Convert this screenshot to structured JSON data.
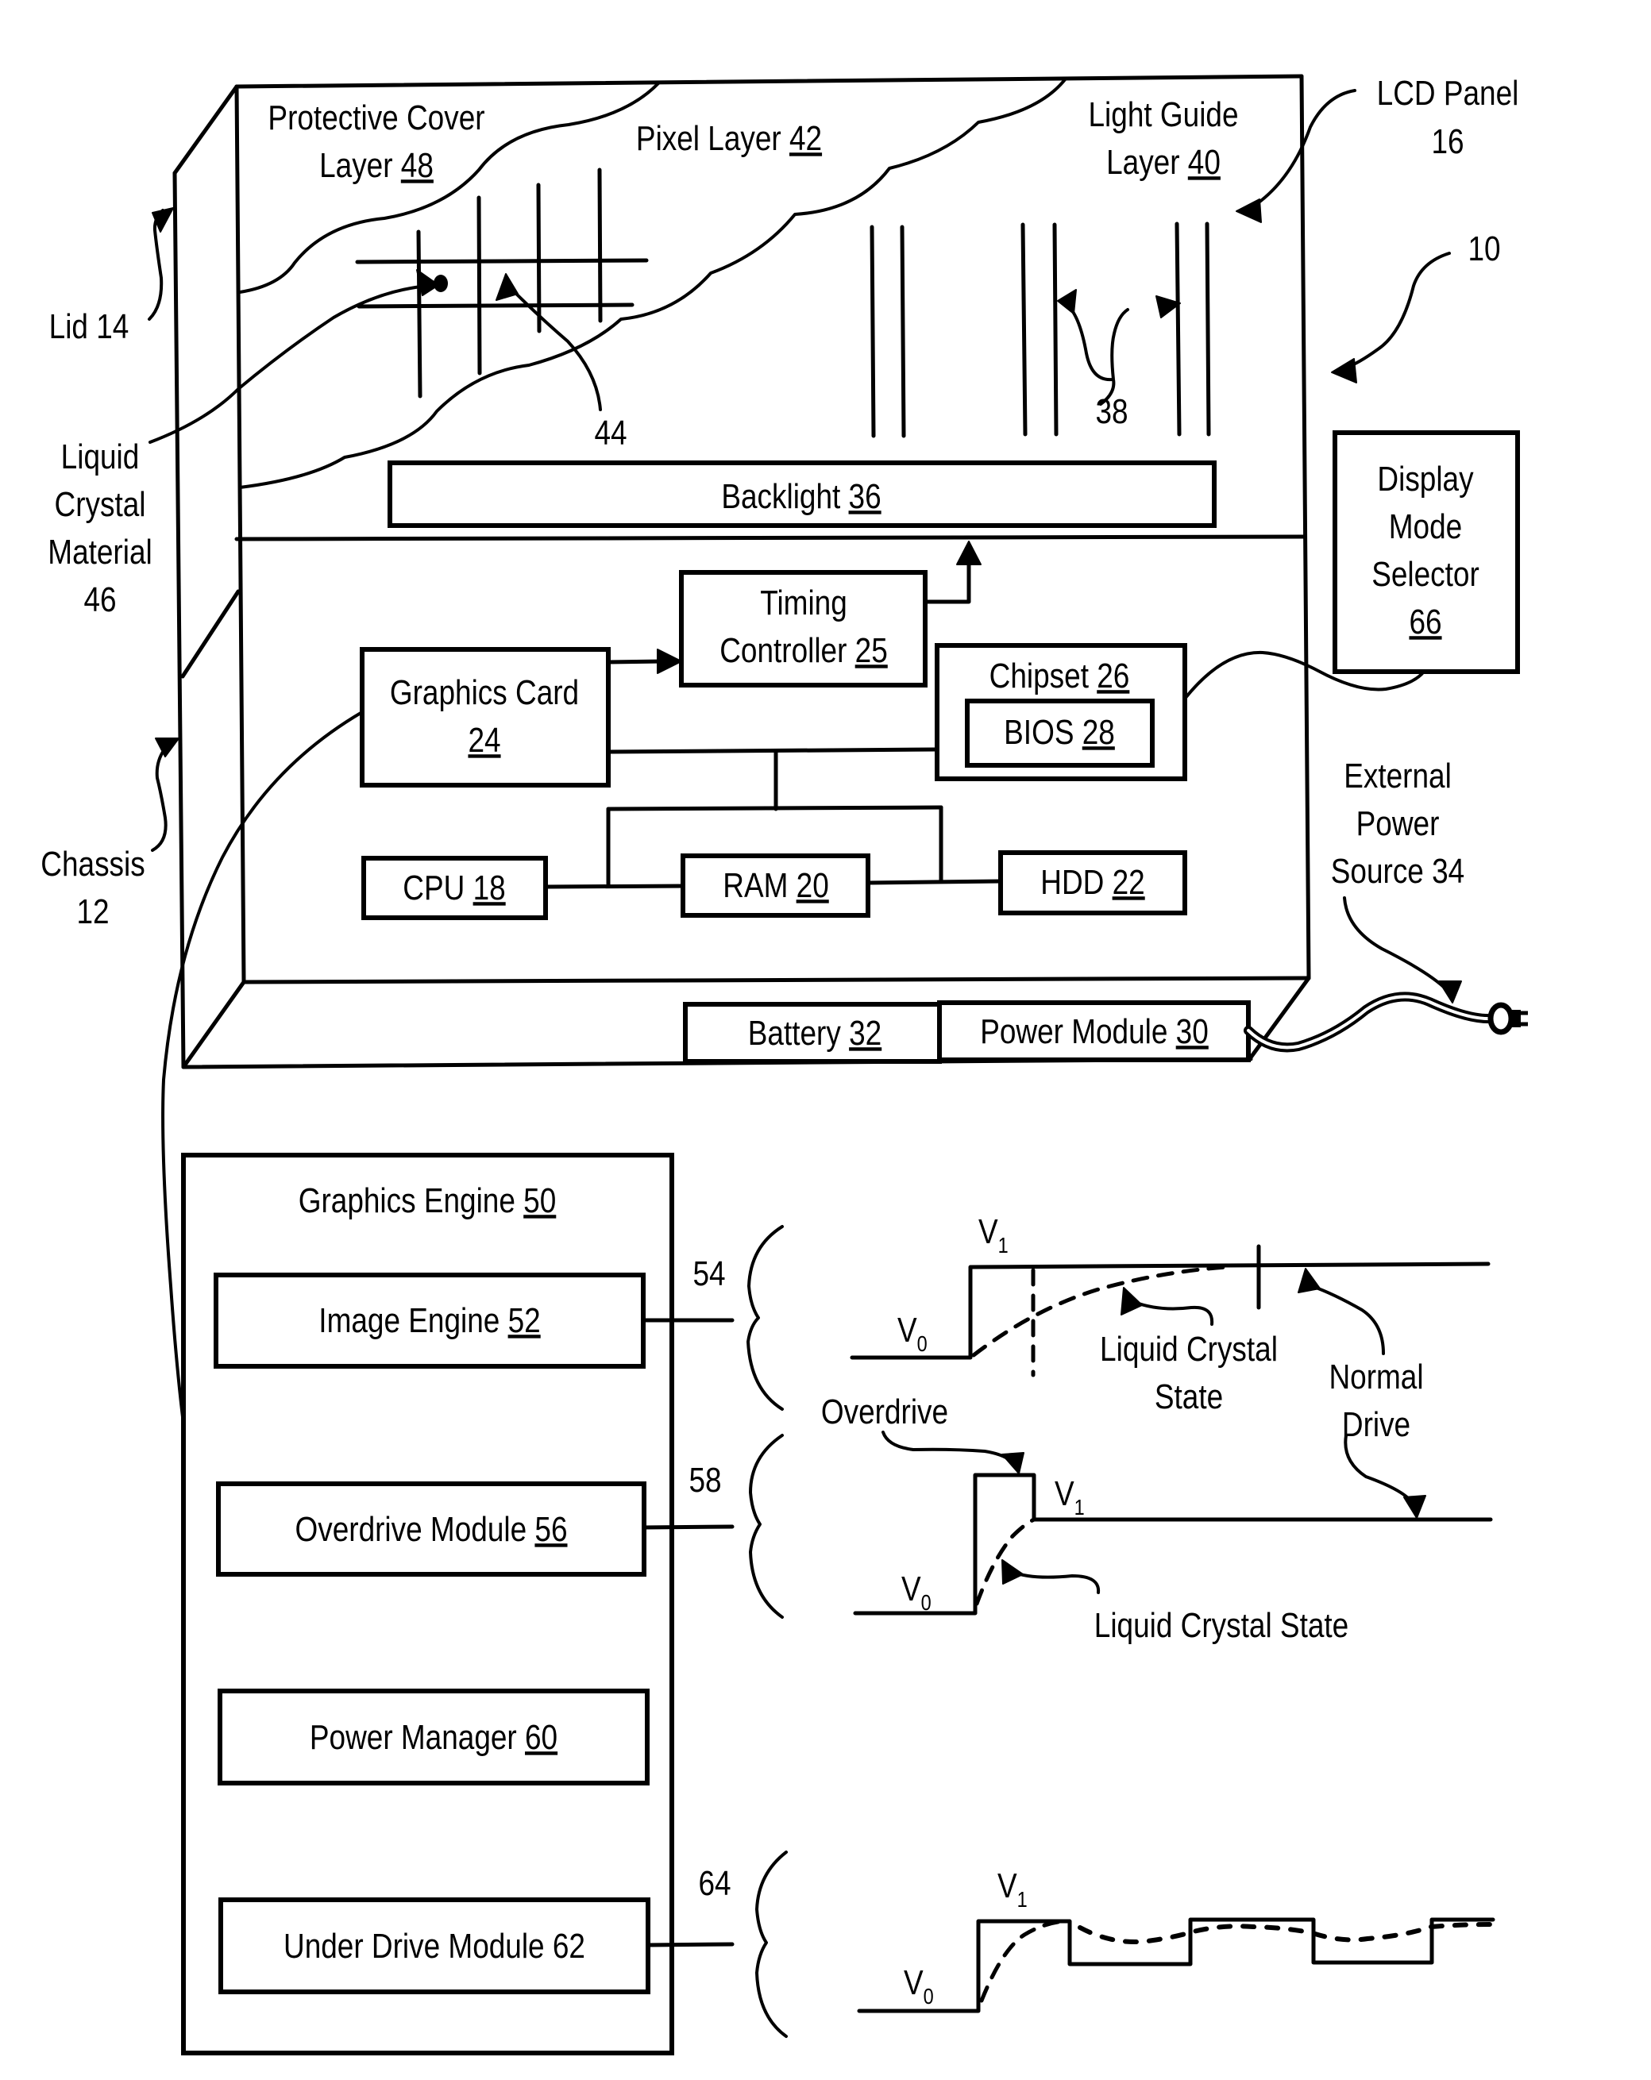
{
  "figure": {
    "type": "patent-block-diagram",
    "subject": "LCD panel display system with graphics engine drive modes"
  },
  "labels": {
    "system_ref": {
      "text": "10"
    },
    "chassis": {
      "lines": [
        {
          "text": "Chassis"
        },
        {
          "text": "12"
        }
      ]
    },
    "lid": {
      "lines": [
        {
          "text": "Lid 14"
        }
      ]
    },
    "lcd_panel": {
      "lines": [
        {
          "text": "LCD Panel"
        },
        {
          "text": "16"
        }
      ]
    },
    "protective_cover": {
      "lines": [
        {
          "text": "Protective Cover"
        },
        {
          "text": "Layer ",
          "ref": "48"
        }
      ]
    },
    "pixel_layer": {
      "lines": [
        {
          "text": "Pixel Layer ",
          "ref": "42"
        }
      ]
    },
    "light_guide": {
      "lines": [
        {
          "text": "Light Guide"
        },
        {
          "text": "Layer ",
          "ref": "40"
        }
      ]
    },
    "liquid_crystal_material": {
      "lines": [
        {
          "text": "Liquid"
        },
        {
          "text": "Crystal"
        },
        {
          "text": "Material"
        },
        {
          "text": "46"
        }
      ]
    },
    "pixel_ref": {
      "text": "44"
    },
    "light_guide_ref": {
      "text": "38"
    },
    "external_power": {
      "lines": [
        {
          "text": "External"
        },
        {
          "text": "Power"
        },
        {
          "text": "Source 34"
        }
      ]
    }
  },
  "blocks": {
    "backlight": {
      "lines": [
        {
          "text": "Backlight ",
          "ref": "36"
        }
      ]
    },
    "timing_controller": {
      "lines": [
        {
          "text": "Timing"
        },
        {
          "text": "Controller ",
          "ref": "25"
        }
      ]
    },
    "graphics_card": {
      "lines": [
        {
          "text": "Graphics Card"
        },
        {
          "text": "",
          "ref": "24"
        }
      ]
    },
    "chipset": {
      "lines": [
        {
          "text": "Chipset ",
          "ref": "26"
        }
      ]
    },
    "bios": {
      "lines": [
        {
          "text": "BIOS ",
          "ref": "28"
        }
      ]
    },
    "cpu": {
      "lines": [
        {
          "text": "CPU ",
          "ref": "18"
        }
      ]
    },
    "ram": {
      "lines": [
        {
          "text": "RAM ",
          "ref": "20"
        }
      ]
    },
    "hdd": {
      "lines": [
        {
          "text": "HDD ",
          "ref": "22"
        }
      ]
    },
    "battery": {
      "lines": [
        {
          "text": "Battery ",
          "ref": "32"
        }
      ]
    },
    "power_module": {
      "lines": [
        {
          "text": "Power Module ",
          "ref": "30"
        }
      ]
    },
    "display_mode_selector": {
      "lines": [
        {
          "text": "Display"
        },
        {
          "text": "Mode"
        },
        {
          "text": "Selector"
        },
        {
          "text": "",
          "ref": "66"
        }
      ]
    },
    "graphics_engine": {
      "lines": [
        {
          "text": "Graphics Engine ",
          "ref": "50"
        }
      ]
    },
    "image_engine": {
      "lines": [
        {
          "text": "Image Engine ",
          "ref": "52"
        }
      ]
    },
    "overdrive_module": {
      "lines": [
        {
          "text": "Overdrive Module ",
          "ref": "56"
        }
      ]
    },
    "power_manager": {
      "lines": [
        {
          "text": "Power Manager ",
          "ref": "60"
        }
      ]
    },
    "under_drive_module": {
      "lines": [
        {
          "text": "Under Drive Module 62"
        }
      ]
    }
  },
  "waveforms": {
    "normal": {
      "ref": "54",
      "v1": "V",
      "v1_sub": "1",
      "v0": "V",
      "v0_sub": "0",
      "lc_state": [
        {
          "text": "Liquid Crystal"
        },
        {
          "text": "State"
        }
      ],
      "normal_drive": [
        {
          "text": "Normal"
        },
        {
          "text": "Drive"
        }
      ]
    },
    "overdrive": {
      "ref": "58",
      "v1": "V",
      "v1_sub": "1",
      "v0": "V",
      "v0_sub": "0",
      "overdrive_label": "Overdrive",
      "lc_state": "Liquid Crystal State"
    },
    "underdrive": {
      "ref": "64",
      "v1": "V",
      "v1_sub": "1",
      "v0": "V",
      "v0_sub": "0"
    }
  }
}
